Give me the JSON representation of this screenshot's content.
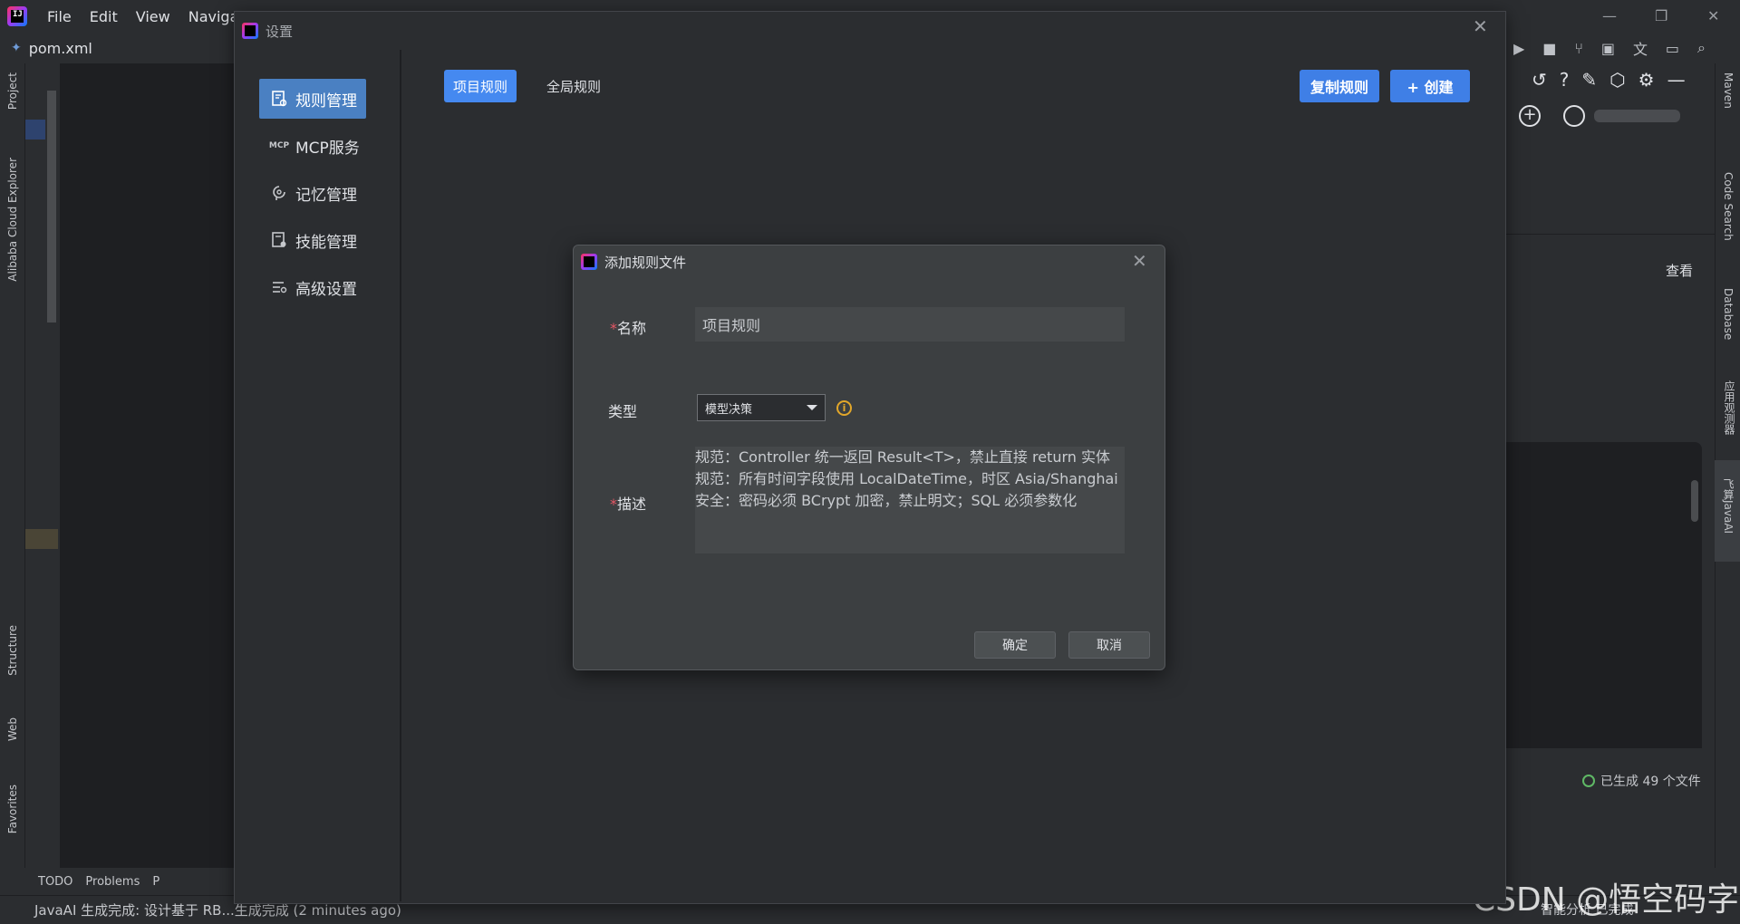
{
  "ide": {
    "menu": [
      "File",
      "Edit",
      "View",
      "Navigate"
    ],
    "file_tab": "pom.xml",
    "left_tools": [
      "Project",
      "Alibaba Cloud Explorer",
      "Structure",
      "Web",
      "Favorites"
    ],
    "bottom_tools": [
      "TODO",
      "Problems",
      "P"
    ],
    "status_message": "JavaAI 生成完成: 设计基于 RB...生成完成 (2 minutes ago)",
    "right_tools": [
      "Maven",
      "Code Search",
      "Database",
      "应用观测器",
      "飞算JavaAI"
    ],
    "view_label": "查看",
    "generated_status": "已生成 49 个文件",
    "right_status": "智能分析   已完成",
    "watermark": "CSDN @悟空码字"
  },
  "settings": {
    "title": "设置",
    "nav": [
      {
        "label": "规则管理",
        "icon": "rules-icon",
        "active": true
      },
      {
        "label": "MCP服务",
        "icon": "mcp-icon",
        "active": false
      },
      {
        "label": "记忆管理",
        "icon": "memory-icon",
        "active": false
      },
      {
        "label": "技能管理",
        "icon": "skills-icon",
        "active": false
      },
      {
        "label": "高级设置",
        "icon": "advanced-settings-icon",
        "active": false
      }
    ],
    "tabs": [
      {
        "label": "项目规则",
        "active": true
      },
      {
        "label": "全局规则",
        "active": false
      }
    ],
    "copy_rules_label": "复制规则",
    "create_label": "+ 创建"
  },
  "dialog": {
    "title": "添加规则文件",
    "name_label": "名称",
    "name_value": "项目规则",
    "type_label": "类型",
    "type_value": "模型决策",
    "desc_label": "描述",
    "desc_lines": [
      "规范：Controller 统一返回 Result<T>，禁止直接 return 实体",
      "规范：所有时间字段使用 LocalDateTime，时区 Asia/Shanghai",
      "安全：密码必须 BCrypt 加密，禁止明文；SQL 必须参数化"
    ],
    "ok_label": "确定",
    "cancel_label": "取消"
  },
  "colors": {
    "accent": "#4589f0",
    "nav_active": "#4a80c2",
    "required": "#e55765",
    "warning": "#e2a72a"
  }
}
